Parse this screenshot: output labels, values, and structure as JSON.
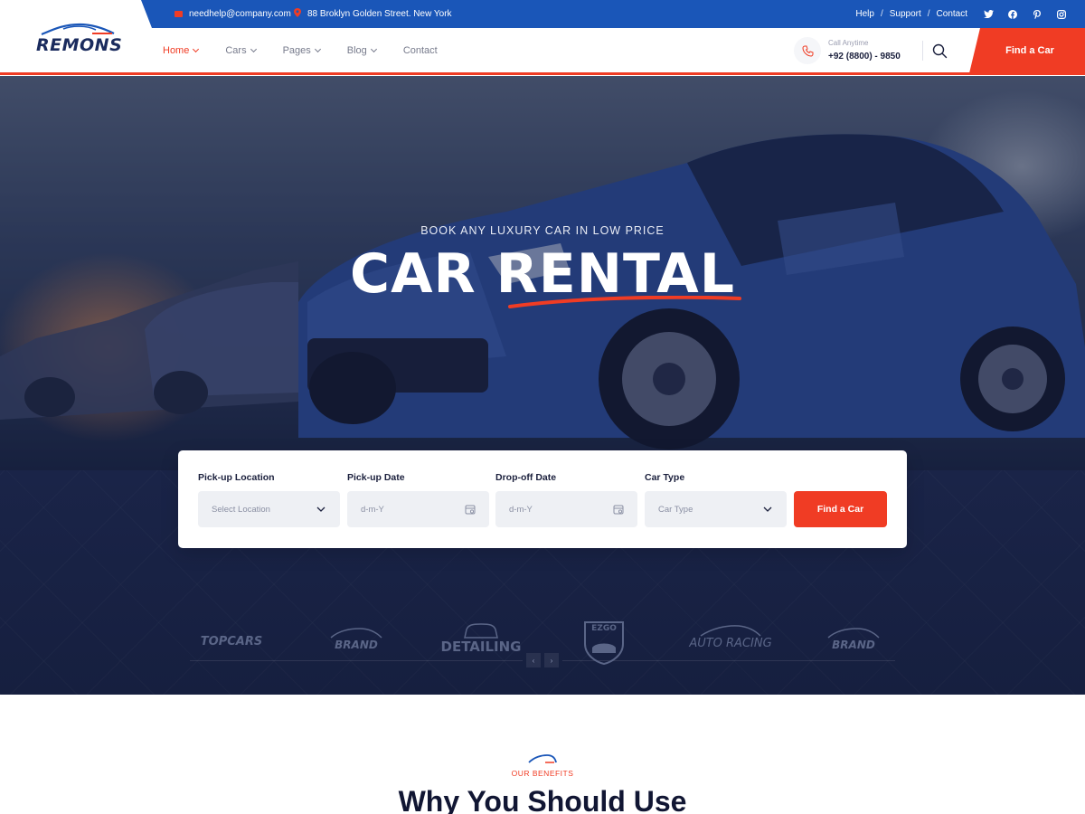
{
  "topbar": {
    "email": "needhelp@company.com",
    "address": "88 Broklyn Golden Street. New York",
    "links": [
      "Help",
      "Support",
      "Contact"
    ],
    "separator": "/",
    "social": [
      {
        "name": "twitter-icon",
        "glyph": "t"
      },
      {
        "name": "facebook-icon",
        "glyph": "f"
      },
      {
        "name": "pinterest-icon",
        "glyph": "p"
      },
      {
        "name": "instagram-icon",
        "glyph": "i"
      }
    ]
  },
  "header": {
    "logo": "REMONS",
    "nav": [
      "Home",
      "Cars",
      "Pages",
      "Blog",
      "Contact"
    ],
    "call_label": "Call Anytime",
    "call_number": "+92 (8800) - 9850",
    "cta": "Find a Car"
  },
  "hero": {
    "subtitle": "BOOK ANY LUXURY CAR IN LOW PRICE",
    "title": "CAR RENTAL"
  },
  "booking": {
    "pickup_location_label": "Pick-up Location",
    "pickup_location_value": "Select Location",
    "pickup_date_label": "Pick-up Date",
    "pickup_date_value": "d-m-Y",
    "dropoff_date_label": "Drop-off Date",
    "dropoff_date_value": "d-m-Y",
    "car_type_label": "Car Type",
    "car_type_value": "Car Type",
    "submit": "Find a Car"
  },
  "brands": {
    "prev": "‹",
    "next": "›",
    "items": [
      "TOPCARS",
      "BRAND",
      "DETAILING",
      "EZGO",
      "AUTO RACING",
      "BRAND"
    ]
  },
  "benefits": {
    "kicker": "OUR BENEFITS",
    "title": "Why You Should Use"
  },
  "colors": {
    "primary_blue": "#1a56b8",
    "accent_red": "#f03c24",
    "navy": "#1a2448"
  }
}
